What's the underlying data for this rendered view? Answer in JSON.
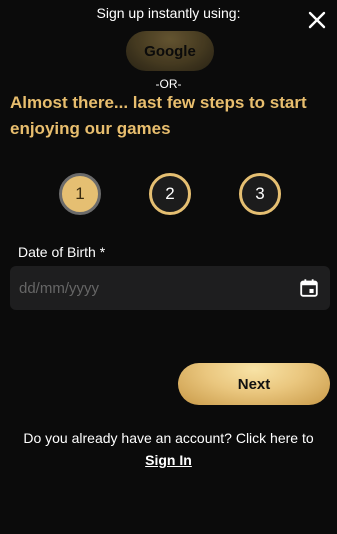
{
  "signup": {
    "caption": "Sign up instantly using:",
    "google_label": "Google",
    "or_text": "-OR-"
  },
  "headline": "Almost there... last few steps to start enjoying our games",
  "stepper": {
    "steps": [
      "1",
      "2",
      "3"
    ],
    "current_step": 1
  },
  "dob": {
    "label": "Date of Birth *",
    "placeholder": "dd/mm/yyyy",
    "value": ""
  },
  "next_label": "Next",
  "footer": {
    "prompt": "Do you already have an account? Click here to",
    "signin_label": "Sign In"
  },
  "icons": {
    "close": "close-icon",
    "calendar": "calendar-icon"
  },
  "colors": {
    "background": "#0b0b0b",
    "accent_gold": "#e8be6e",
    "field_bg": "#1e1e1f"
  }
}
